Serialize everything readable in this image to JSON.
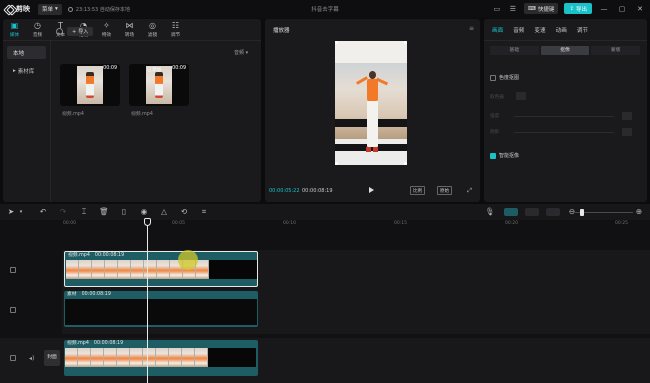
{
  "titlebar": {
    "app_name": "剪映",
    "menu_label": "菜单",
    "autosave": "23:13:53 自动保存本地",
    "doc_title": "抖音去字幕",
    "shortcut_label": "快捷键",
    "export_label": "导出"
  },
  "media": {
    "tabs": [
      {
        "label": "媒体",
        "icon": "media-icon"
      },
      {
        "label": "音频",
        "icon": "audio-icon"
      },
      {
        "label": "文本",
        "icon": "text-icon"
      },
      {
        "label": "贴纸",
        "icon": "sticker-icon"
      },
      {
        "label": "特效",
        "icon": "effects-icon"
      },
      {
        "label": "转场",
        "icon": "transition-icon"
      },
      {
        "label": "滤镜",
        "icon": "filter-icon"
      },
      {
        "label": "调节",
        "icon": "adjust-icon"
      }
    ],
    "side": [
      "本地",
      "素材库"
    ],
    "import_label": "导入",
    "sort_label": "音频",
    "clips": [
      {
        "name": "视频.mp4",
        "duration": "00:09",
        "added": ""
      },
      {
        "name": "视频.mp4",
        "duration": "00:09",
        "added": "已添加"
      }
    ]
  },
  "player": {
    "title": "播放器",
    "current_time": "00:00:05:22",
    "total_time": "00:00:08:19",
    "ratio_label": "比例",
    "original_label": "原始"
  },
  "props": {
    "tabs": [
      "画面",
      "音频",
      "变速",
      "动画",
      "调节"
    ],
    "sub_tabs": [
      "基础",
      "抠像",
      "蒙版"
    ],
    "checkboxes": [
      {
        "label": "色度抠图",
        "checked": false
      },
      {
        "label": "智能抠像",
        "checked": true
      }
    ],
    "ghost_labels": [
      "取色器",
      "强度",
      "阴影"
    ]
  },
  "timeline": {
    "ruler": [
      "00:00",
      "00:05",
      "00:10",
      "00:15",
      "00:20",
      "00:25"
    ],
    "tracks": [
      {
        "clip_name": "视频.mp4",
        "clip_duration": "00:00:08:19"
      },
      {
        "clip_name": "素材",
        "clip_duration": "00:00:08:19"
      },
      {
        "clip_name": "视频.mp4",
        "clip_duration": "00:00:08:19"
      }
    ],
    "cover_label": "封面"
  },
  "colors": {
    "accent": "#19c1c9",
    "clip": "#1f5d64",
    "panel": "#1a1a1d"
  }
}
